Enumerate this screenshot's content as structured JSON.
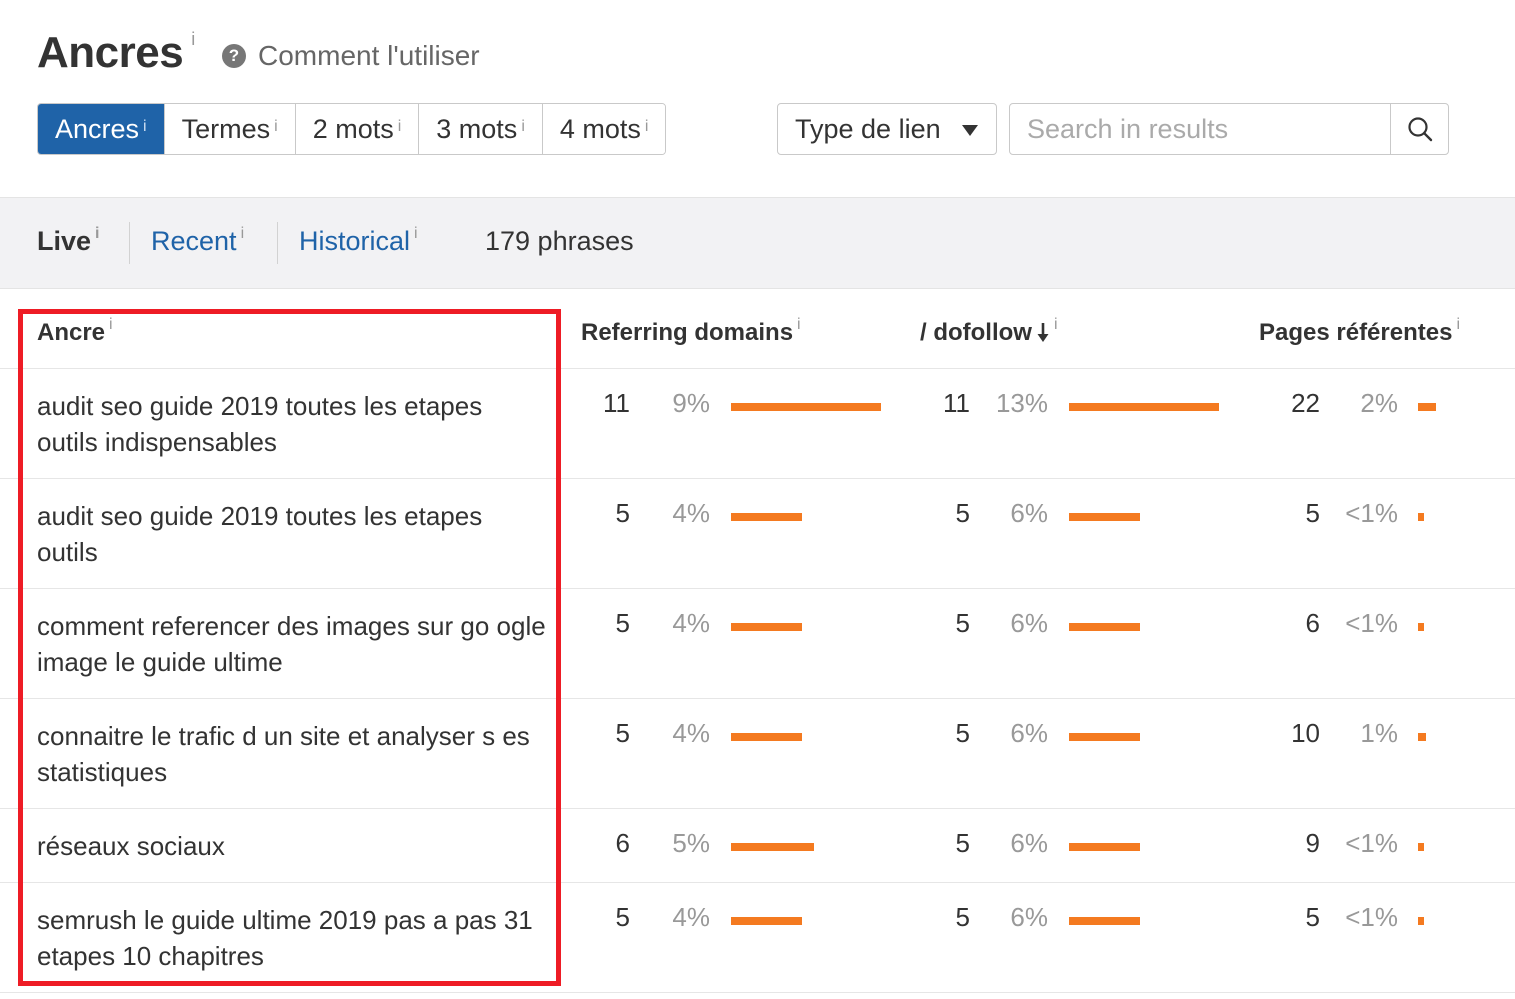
{
  "header": {
    "title": "Ancres",
    "title_info": "i",
    "help_icon": "question-circle-icon",
    "help_label": "Comment l'utiliser"
  },
  "tabs": [
    {
      "label": "Ancres",
      "info": "i",
      "active": true
    },
    {
      "label": "Termes",
      "info": "i",
      "active": false
    },
    {
      "label": "2 mots",
      "info": "i",
      "active": false
    },
    {
      "label": "3 mots",
      "info": "i",
      "active": false
    },
    {
      "label": "4 mots",
      "info": "i",
      "active": false
    }
  ],
  "filter": {
    "label": "Type de lien",
    "icon": "caret-down-icon"
  },
  "search": {
    "placeholder": "Search in results",
    "icon": "search-icon"
  },
  "modes": {
    "live": "Live",
    "recent": "Recent",
    "historical": "Historical",
    "info": "i",
    "count": "179 phrases"
  },
  "table": {
    "headers": {
      "anchor": "Ancre",
      "referring_domains": "Referring domains",
      "dofollow": "/ dofollow",
      "sort_icon": "sort-down-arrow-icon",
      "referring_pages": "Pages référentes",
      "info": "i"
    },
    "rows": [
      {
        "anchor": "audit seo guide 2019 toutes les etapes outils indispensables",
        "rd": "11",
        "rd_pct": "9%",
        "rd_share": 1.0,
        "df": "11",
        "df_pct": "13%",
        "df_share": 1.0,
        "rp": "22",
        "rp_pct": "2%",
        "rp_share": 0.12
      },
      {
        "anchor": "audit seo guide 2019 toutes les etapes outils",
        "rd": "5",
        "rd_pct": "4%",
        "rd_share": 0.47,
        "df": "5",
        "df_pct": "6%",
        "df_share": 0.47,
        "rp": "5",
        "rp_pct": "<1%",
        "rp_share": 0.03
      },
      {
        "anchor": "comment referencer des images sur go ogle image le guide ultime",
        "rd": "5",
        "rd_pct": "4%",
        "rd_share": 0.47,
        "df": "5",
        "df_pct": "6%",
        "df_share": 0.47,
        "rp": "6",
        "rp_pct": "<1%",
        "rp_share": 0.03
      },
      {
        "anchor": "connaitre le trafic d un site et analyser s es statistiques",
        "rd": "5",
        "rd_pct": "4%",
        "rd_share": 0.47,
        "df": "5",
        "df_pct": "6%",
        "df_share": 0.47,
        "rp": "10",
        "rp_pct": "1%",
        "rp_share": 0.05
      },
      {
        "anchor": "réseaux sociaux",
        "rd": "6",
        "rd_pct": "5%",
        "rd_share": 0.55,
        "df": "5",
        "df_pct": "6%",
        "df_share": 0.47,
        "rp": "9",
        "rp_pct": "<1%",
        "rp_share": 0.03
      },
      {
        "anchor": "semrush le guide ultime 2019 pas a pas 31 etapes 10 chapitres",
        "rd": "5",
        "rd_pct": "4%",
        "rd_share": 0.47,
        "df": "5",
        "df_pct": "6%",
        "df_share": 0.47,
        "rp": "5",
        "rp_pct": "<1%",
        "rp_share": 0.03
      }
    ]
  },
  "colors": {
    "accent": "#1f63a8",
    "bar": "#f47a20",
    "highlight": "#ee1c25"
  }
}
